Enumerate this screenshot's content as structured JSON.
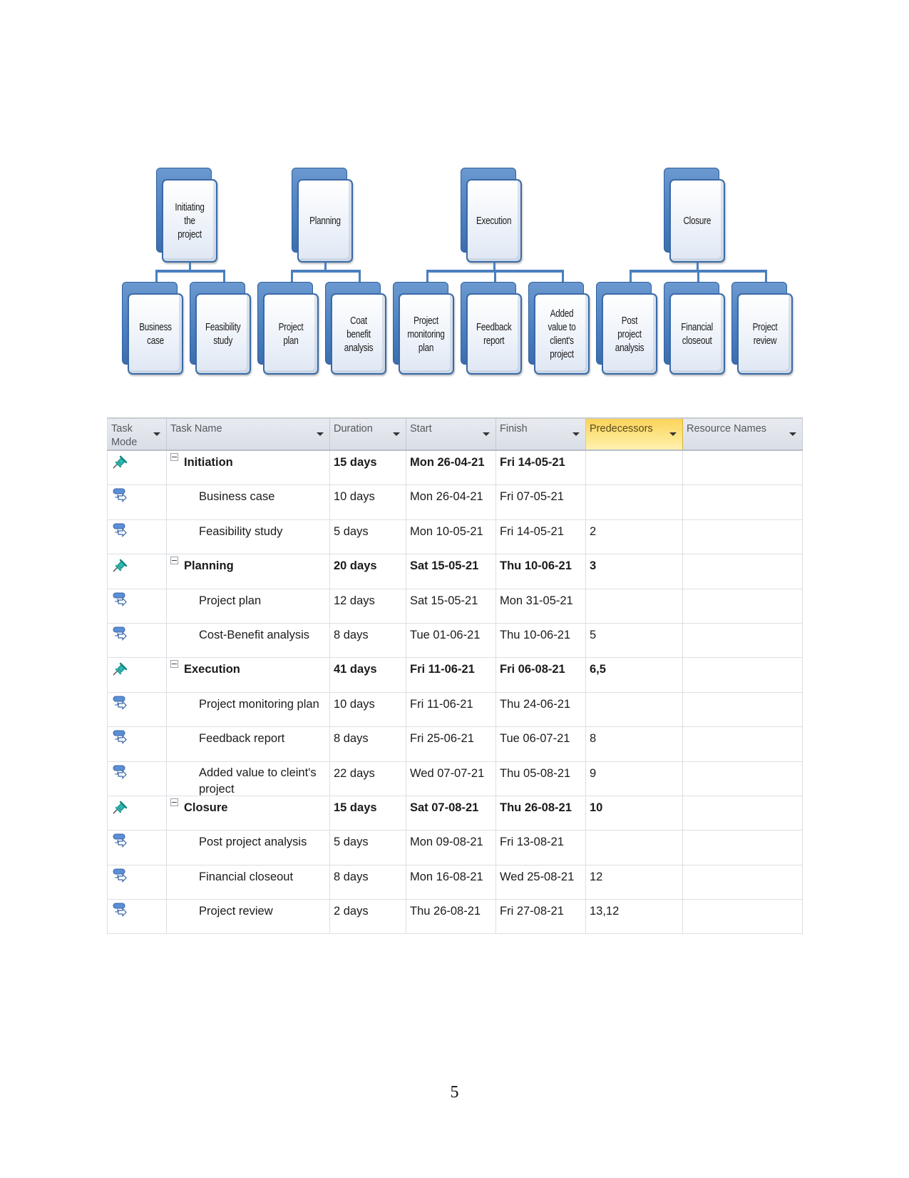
{
  "wbs": {
    "phases": [
      {
        "label": "Initiating the\nproject",
        "children": [
          "Business case",
          "Feasibility\nstudy"
        ]
      },
      {
        "label": "Planning",
        "children": [
          "Project plan",
          "Coat benefit\nanalysis"
        ]
      },
      {
        "label": "Execution",
        "children": [
          "Project\nmonitoring\nplan",
          "Feedback\nreport",
          "Added value to\nclient's project"
        ]
      },
      {
        "label": "Closure",
        "children": [
          "Post project\nanalysis",
          "Financial\ncloseout",
          "Project review"
        ]
      }
    ]
  },
  "table": {
    "columns": {
      "mode": "Task\nMode",
      "name": "Task Name",
      "duration": "Duration",
      "start": "Start",
      "finish": "Finish",
      "predecessors": "Predecessors",
      "resources": "Resource Names"
    },
    "highlighted_column": "predecessors",
    "highlight_color": "#fcd865",
    "rows": [
      {
        "mode": "manual",
        "summary": true,
        "name": "Initiation",
        "duration": "15 days",
        "start": "Mon 26-04-21",
        "finish": "Fri 14-05-21",
        "predecessors": "",
        "resources": ""
      },
      {
        "mode": "auto",
        "summary": false,
        "name": "Business case",
        "duration": "10 days",
        "start": "Mon 26-04-21",
        "finish": "Fri 07-05-21",
        "predecessors": "",
        "resources": ""
      },
      {
        "mode": "auto",
        "summary": false,
        "name": "Feasibility study",
        "duration": "5 days",
        "start": "Mon 10-05-21",
        "finish": "Fri 14-05-21",
        "predecessors": "2",
        "resources": ""
      },
      {
        "mode": "manual",
        "summary": true,
        "name": "Planning",
        "duration": "20 days",
        "start": "Sat 15-05-21",
        "finish": "Thu 10-06-21",
        "predecessors": "3",
        "resources": ""
      },
      {
        "mode": "auto",
        "summary": false,
        "name": "Project plan",
        "duration": "12 days",
        "start": "Sat 15-05-21",
        "finish": "Mon 31-05-21",
        "predecessors": "",
        "resources": ""
      },
      {
        "mode": "auto",
        "summary": false,
        "name": "Cost-Benefit analysis",
        "duration": "8 days",
        "start": "Tue 01-06-21",
        "finish": "Thu 10-06-21",
        "predecessors": "5",
        "resources": ""
      },
      {
        "mode": "manual",
        "summary": true,
        "name": "Execution",
        "duration": "41 days",
        "start": "Fri 11-06-21",
        "finish": "Fri 06-08-21",
        "predecessors": "6,5",
        "resources": ""
      },
      {
        "mode": "auto",
        "summary": false,
        "name": "Project monitoring plan",
        "duration": "10 days",
        "start": "Fri 11-06-21",
        "finish": "Thu 24-06-21",
        "predecessors": "",
        "resources": ""
      },
      {
        "mode": "auto",
        "summary": false,
        "name": "Feedback report",
        "duration": "8 days",
        "start": "Fri 25-06-21",
        "finish": "Tue 06-07-21",
        "predecessors": "8",
        "resources": ""
      },
      {
        "mode": "auto",
        "summary": false,
        "name": "Added value to cleint's project",
        "duration": "22 days",
        "start": "Wed 07-07-21",
        "finish": "Thu 05-08-21",
        "predecessors": "9",
        "resources": ""
      },
      {
        "mode": "manual",
        "summary": true,
        "name": "Closure",
        "duration": "15 days",
        "start": "Sat 07-08-21",
        "finish": "Thu 26-08-21",
        "predecessors": "10",
        "resources": ""
      },
      {
        "mode": "auto",
        "summary": false,
        "name": "Post project analysis",
        "duration": "5 days",
        "start": "Mon 09-08-21",
        "finish": "Fri 13-08-21",
        "predecessors": "",
        "resources": ""
      },
      {
        "mode": "auto",
        "summary": false,
        "name": "Financial closeout",
        "duration": "8 days",
        "start": "Mon 16-08-21",
        "finish": "Wed 25-08-21",
        "predecessors": "12",
        "resources": ""
      },
      {
        "mode": "auto",
        "summary": false,
        "name": "Project review",
        "duration": "2 days",
        "start": "Thu 26-08-21",
        "finish": "Fri 27-08-21",
        "predecessors": "13,12",
        "resources": ""
      }
    ]
  },
  "icons": {
    "manual": "pushpin-icon",
    "auto": "auto-scheduled-task-icon"
  },
  "page_number": "5"
}
